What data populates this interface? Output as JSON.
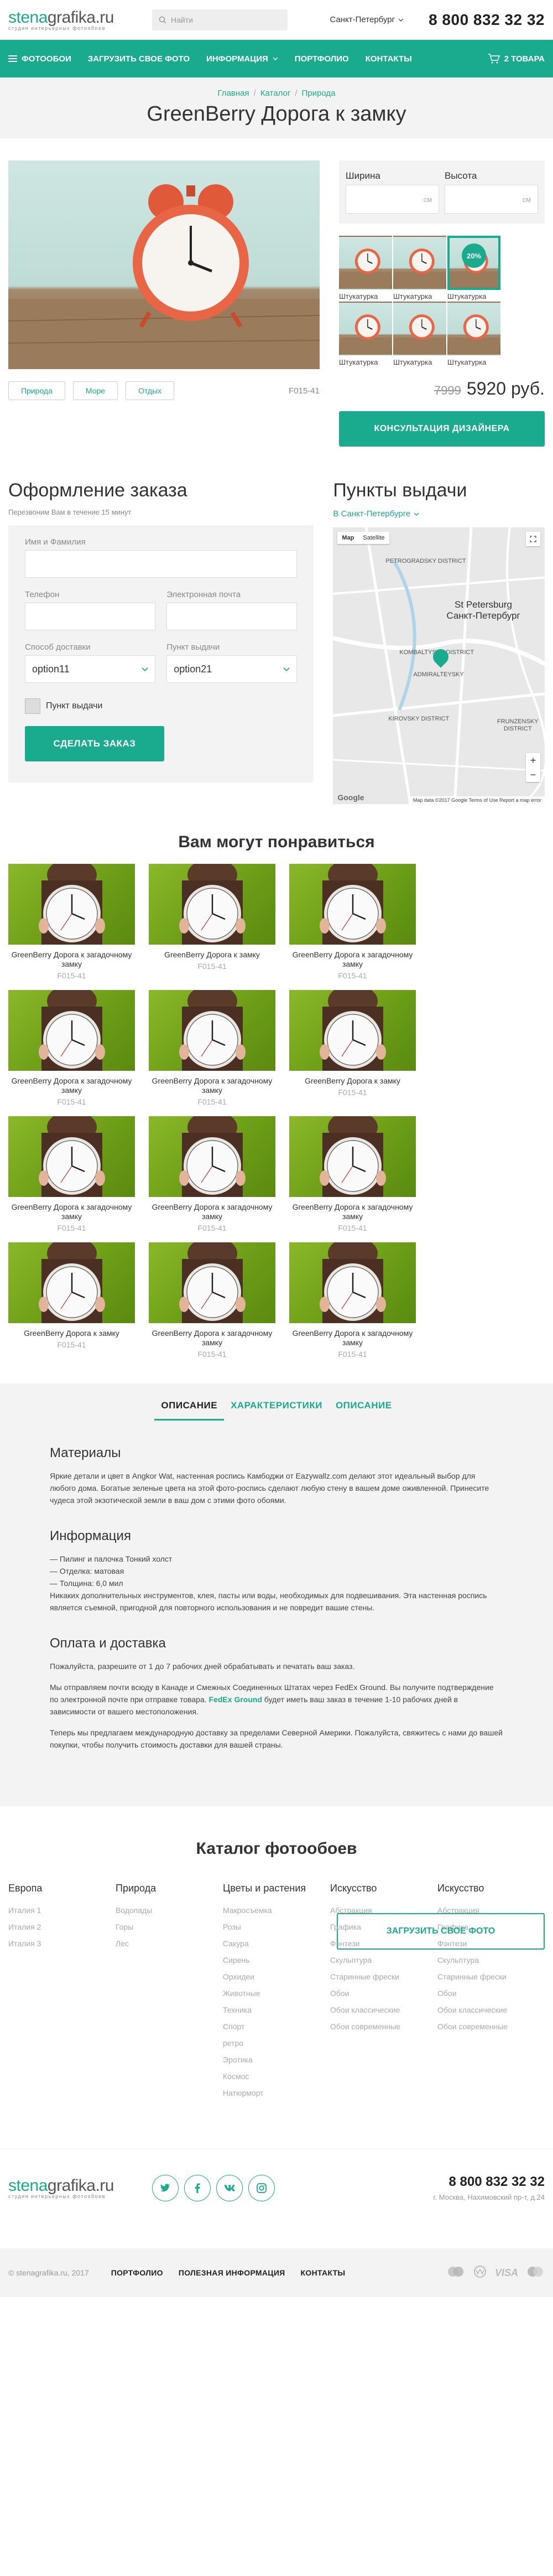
{
  "header": {
    "logo_part1": "stena",
    "logo_part2": "grafika",
    "logo_part3": ".ru",
    "logo_tagline": "студия интерьерных фотообоев",
    "search_placeholder": "Найти",
    "city": "Санкт-Петербург",
    "phone": "8 800 832 32 32"
  },
  "nav": {
    "items": [
      "Фотообои",
      "Загрузить свое фото",
      "Информация",
      "Портфолио",
      "Контакты"
    ],
    "cart": "2 товара"
  },
  "breadcrumbs": [
    "Главная",
    "Каталог",
    "Природа"
  ],
  "page_title": "GreenBerry Дорога к замку",
  "product": {
    "tags": [
      "Природа",
      "Море",
      "Отдых"
    ],
    "sku": "F015-41",
    "width_label": "Ширина",
    "height_label": "Высота",
    "unit": "см",
    "thumbs": [
      {
        "label": "Штукатурка",
        "badge": ""
      },
      {
        "label": "Штукатурка",
        "badge": ""
      },
      {
        "label": "Штукатурка",
        "badge": "20%"
      },
      {
        "label": "Штукатурка",
        "badge": ""
      },
      {
        "label": "Штукатурка",
        "badge": ""
      },
      {
        "label": "Штукатурка",
        "badge": ""
      }
    ],
    "selected_thumb_index": 2,
    "price_old": "7999",
    "price_new": "5920 руб.",
    "consult_button": "Консультация дизайнера"
  },
  "order": {
    "title": "Оформление заказа",
    "subtitle": "Перезвоним Вам в течение 15 минут",
    "name_label": "Имя и Фамилия",
    "phone_label": "Телефон",
    "email_label": "Электронная почта",
    "delivery_label": "Способ доставки",
    "delivery_value": "option11",
    "pickup_point_label": "Пункт выдачи",
    "pickup_point_value": "option21",
    "pickup_checkbox": "Пункт выдачи",
    "submit": "Сделать заказ"
  },
  "pickup": {
    "title": "Пункты выдачи",
    "city": "В Санкт-Петербурге",
    "map_type_map": "Map",
    "map_type_sat": "Satellite",
    "map_labels": [
      "PETROGRADSKY DISTRICT",
      "St Petersburg",
      "Санкт-Петербург",
      "KOMBALTYSKY DISTRICT",
      "ADMIRALTEYSKY",
      "KIROVSKY DISTRICT",
      "FRUNZENSKY DISTRICT"
    ],
    "map_footer": "Map data ©2017 Google   Terms of Use   Report a map error",
    "map_brand": "Google"
  },
  "recommend": {
    "title": "Вам могут понравиться",
    "items": [
      {
        "name": "GreenBerry Дорога к загадочному замку",
        "sku": "F015-41"
      },
      {
        "name": "GreenBerry Дорога к замку",
        "sku": "F015-41"
      },
      {
        "name": "GreenBerry Дорога к загадочному замку",
        "sku": "F015-41"
      },
      {
        "name": "GreenBerry Дорога к загадочному замку",
        "sku": "F015-41"
      },
      {
        "name": "GreenBerry Дорога к загадочному замку",
        "sku": "F015-41"
      },
      {
        "name": "GreenBerry Дорога к замку",
        "sku": "F015-41"
      },
      {
        "name": "GreenBerry Дорога к загадочному замку",
        "sku": "F015-41"
      },
      {
        "name": "GreenBerry Дорога к загадочному замку",
        "sku": "F015-41"
      },
      {
        "name": "GreenBerry Дорога к загадочному замку",
        "sku": "F015-41"
      },
      {
        "name": "GreenBerry Дорога к замку",
        "sku": "F015-41"
      },
      {
        "name": "GreenBerry Дорога к загадочному замку",
        "sku": "F015-41"
      },
      {
        "name": "GreenBerry Дорога к загадочному замку",
        "sku": "F015-41"
      }
    ]
  },
  "description": {
    "tabs": [
      "Описание",
      "Характеристики",
      "Описание"
    ],
    "materials_title": "Материалы",
    "materials_text": "Яркие детали и цвет в Angkor Wat, настенная роспись Камбоджи от Eazywallz.com делают этот идеальный выбор для любого дома. Богатые зеленые цвета на этой фото-роспись сделают любую стену в вашем доме оживленной. Принесите чудеса этой экзотической земли в ваш дом с этими фото обоями.",
    "info_title": "Информация",
    "info_lines": [
      "— Пилинг и палочка Тонкий холст",
      "— Отделка: матовая",
      "— Толщина: 6,0 мил",
      "Никаких дополнительных инструментов, клея, пасты или воды, необходимых для подвешивания. Эта настенная роспись является съемной, пригодной для повторного использования и не повредит вашие стены."
    ],
    "payment_title": "Оплата и доставка",
    "payment_p1": "Пожалуйста, разрешите от 1 до 7 рабочих дней обрабатывать и печатать ваш заказ.",
    "payment_p2_a": "Мы отправляем почти всюду в Канаде и Смежных Соединенных Штатах через FedEx Ground. Вы получите подтверждение по электронной почте при отправке товара.",
    "payment_p2_hl": "FedEx Ground",
    "payment_p2_b": "будет иметь ваш заказ в течение 1-10 рабочих дней в зависимости от вашего местоположения.",
    "payment_p3": "Теперь мы предлагаем международную доставку за пределами Северной Америки. Пожалуйста, свяжитесь с нами до вашей покупки, чтобы получить стоимость доставки для вашей страны."
  },
  "catalog": {
    "title": "Каталог фотообоев",
    "columns": [
      {
        "head": "Европа",
        "items": [
          "Италия 1",
          "Италия 2",
          "Италия 3"
        ]
      },
      {
        "head": "Природа",
        "items": [
          "Водопады",
          "Горы",
          "Лес"
        ]
      },
      {
        "head": "Цветы и растения",
        "items": [
          "Макросъемка",
          "Розы",
          "Сакура",
          "Сирень",
          "Орхидеи",
          "Животные",
          "Техника",
          "Спорт",
          "ретро",
          "Эротика",
          "Космос",
          "Натюрморт"
        ]
      },
      {
        "head": "Искусство",
        "items": [
          "Абстракция",
          "Графика",
          "Фэнтези",
          "Скульптура",
          "Старинные фрески",
          "Обои",
          "Обои классические",
          "Обои современные"
        ]
      },
      {
        "head": "Искусство",
        "items": [
          "Абстракция",
          "Графика",
          "Фэнтези",
          "Скульптура",
          "Старинные фрески",
          "Обои",
          "Обои классические",
          "Обои современные"
        ]
      }
    ],
    "upload_button": "Загрузить свое фото"
  },
  "footer": {
    "socials": [
      "t",
      "f",
      "vk",
      "ig"
    ],
    "phone": "8 800 832 32 32",
    "address": "г. Москва, Нахимовский пр-т, д.24",
    "copyright": "© stenagrafika.ru, 2017",
    "links": [
      "Портфолио",
      "Полезная информация",
      "Контакты"
    ],
    "payments": [
      "MC",
      "WM",
      "VISA",
      "MC"
    ]
  },
  "colors": {
    "accent": "#1aaa8d",
    "bg_gray": "#f3f3f3"
  }
}
